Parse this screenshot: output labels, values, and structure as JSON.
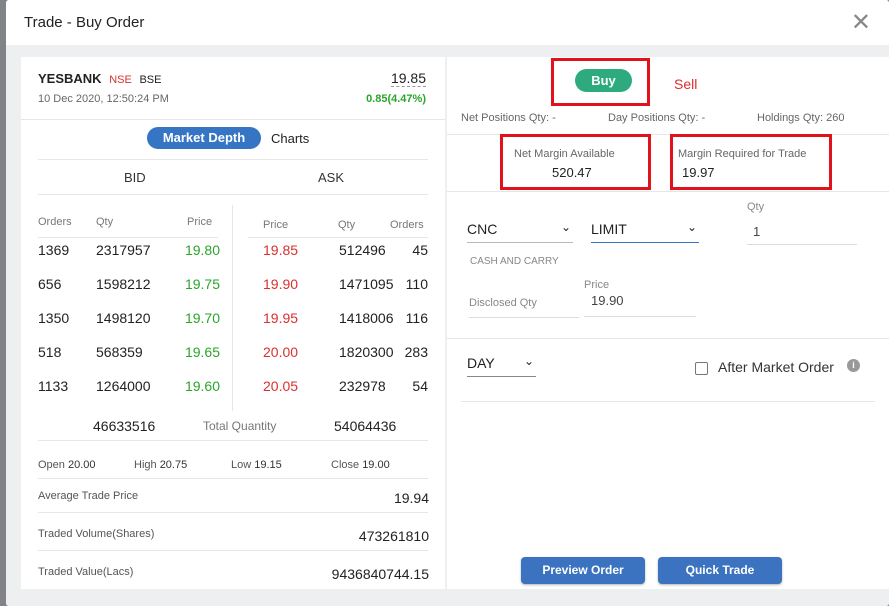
{
  "title": "Trade - Buy Order",
  "stock": {
    "symbol": "YESBANK",
    "nse": "NSE",
    "bse": "BSE",
    "datetime": "10 Dec 2020, 12:50:24 PM",
    "price": "19.85",
    "change": "0.85(4.47%)"
  },
  "tabs": {
    "market_depth": "Market Depth",
    "charts": "Charts"
  },
  "depth": {
    "bid": "BID",
    "ask": "ASK",
    "bid_headers": [
      "Orders",
      "Qty",
      "Price"
    ],
    "ask_headers": [
      "Price",
      "Qty",
      "Orders"
    ],
    "bids": [
      {
        "orders": "1369",
        "qty": "2317957",
        "price": "19.80"
      },
      {
        "orders": "656",
        "qty": "1598212",
        "price": "19.75"
      },
      {
        "orders": "1350",
        "qty": "1498120",
        "price": "19.70"
      },
      {
        "orders": "518",
        "qty": "568359",
        "price": "19.65"
      },
      {
        "orders": "1133",
        "qty": "1264000",
        "price": "19.60"
      }
    ],
    "asks": [
      {
        "price": "19.85",
        "qty": "512496",
        "orders": "45"
      },
      {
        "price": "19.90",
        "qty": "1471095",
        "orders": "110"
      },
      {
        "price": "19.95",
        "qty": "1418006",
        "orders": "116"
      },
      {
        "price": "20.00",
        "qty": "1820300",
        "orders": "283"
      },
      {
        "price": "20.05",
        "qty": "232978",
        "orders": "54"
      }
    ],
    "total_bid": "46633516",
    "total_label": "Total Quantity",
    "total_ask": "54064436"
  },
  "ohlc": {
    "open_label": "Open",
    "open": "20.00",
    "high_label": "High",
    "high": "20.75",
    "low_label": "Low",
    "low": "19.15",
    "close_label": "Close",
    "close": "19.00"
  },
  "stats": [
    {
      "label": "Average Trade Price",
      "value": "19.94"
    },
    {
      "label": "Traded Volume(Shares)",
      "value": "473261810"
    },
    {
      "label": "Traded Value(Lacs)",
      "value": "9436840744.15"
    }
  ],
  "order": {
    "buy": "Buy",
    "sell": "Sell",
    "net_positions": "Net Positions Qty: -",
    "day_positions": "Day Positions Qty: -",
    "holdings": "Holdings Qty: 260",
    "net_margin_label": "Net Margin Available",
    "net_margin": "520.47",
    "margin_req_label": "Margin Required for Trade",
    "margin_req": "19.97",
    "product": "CNC",
    "product_desc": "CASH AND CARRY",
    "order_type": "LIMIT",
    "qty_label": "Qty",
    "qty": "1",
    "disclosed_label": "Disclosed Qty",
    "price_label": "Price",
    "price": "19.90",
    "validity": "DAY",
    "amo_label": "After Market Order",
    "preview_btn": "Preview Order",
    "quick_btn": "Quick Trade"
  },
  "colors": {
    "accent": "#3b73c0",
    "buy": "#2eab7e",
    "bid_price": "#2aa52a",
    "ask_price": "#d9302e",
    "highlight": "#e0121b"
  }
}
